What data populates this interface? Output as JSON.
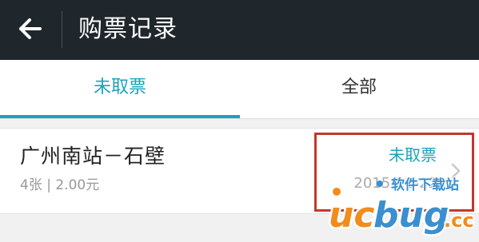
{
  "header": {
    "title": "购票记录",
    "back_icon": "arrow-left-icon",
    "background": "#1f262c"
  },
  "tabs": [
    {
      "label": "未取票",
      "active": true
    },
    {
      "label": "全部",
      "active": false
    }
  ],
  "accent_color": "#1aa3b8",
  "ticket": {
    "route": "广州南站－石壁",
    "details": "4张 | 2.00元",
    "status": "未取票",
    "date": "2015-12-22",
    "chevron_icon": "chevron-right-icon"
  },
  "highlight_color": "#c0392b",
  "watermark": {
    "site_name": "软件下载站",
    "logo_text": "ucbug.cc"
  }
}
